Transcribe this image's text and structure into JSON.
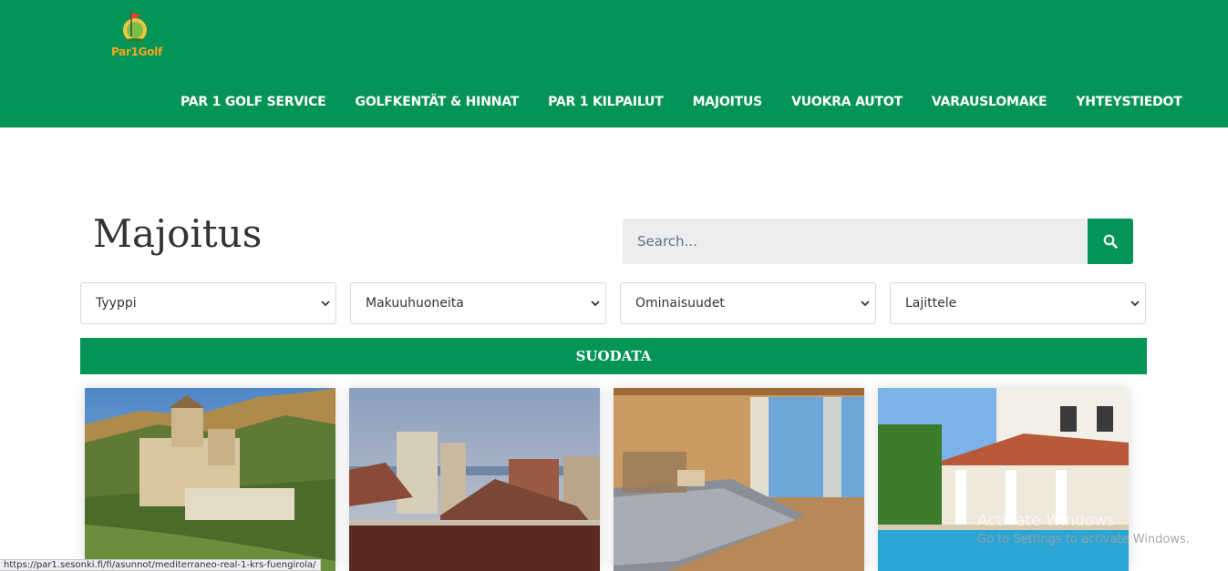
{
  "brand": {
    "logo_text": "Par1Golf",
    "color": "#049455",
    "logo_accent": "#f5a623"
  },
  "nav": [
    {
      "label": "PAR 1 GOLF SERVICE"
    },
    {
      "label": "GOLFKENTÄT & HINNAT"
    },
    {
      "label": "PAR 1 KILPAILUT"
    },
    {
      "label": "MAJOITUS"
    },
    {
      "label": "VUOKRA AUTOT"
    },
    {
      "label": "VARAUSLOMAKE"
    },
    {
      "label": "YHTEYSTIEDOT"
    }
  ],
  "page": {
    "title": "Majoitus"
  },
  "search": {
    "placeholder": "Search...",
    "icon": "search-icon"
  },
  "filters": [
    {
      "selected": "Tyyppi"
    },
    {
      "selected": "Makuuhuoneita"
    },
    {
      "selected": "Ominaisuudet"
    },
    {
      "selected": "Lajittele"
    }
  ],
  "filter_button": {
    "label": "SUODATA"
  },
  "cards": [
    {
      "image": "castle-hotel-photo"
    },
    {
      "image": "rooftops-sea-photo"
    },
    {
      "image": "bedroom-photo"
    },
    {
      "image": "villa-pool-photo"
    }
  ],
  "statusbar": {
    "url": "https://par1.sesonki.fi/fi/asunnot/mediterraneo-real-1-krs-fuengirola/"
  },
  "watermark": {
    "line1": "Activate Windows",
    "line2": "Go to Settings to activate Windows."
  }
}
